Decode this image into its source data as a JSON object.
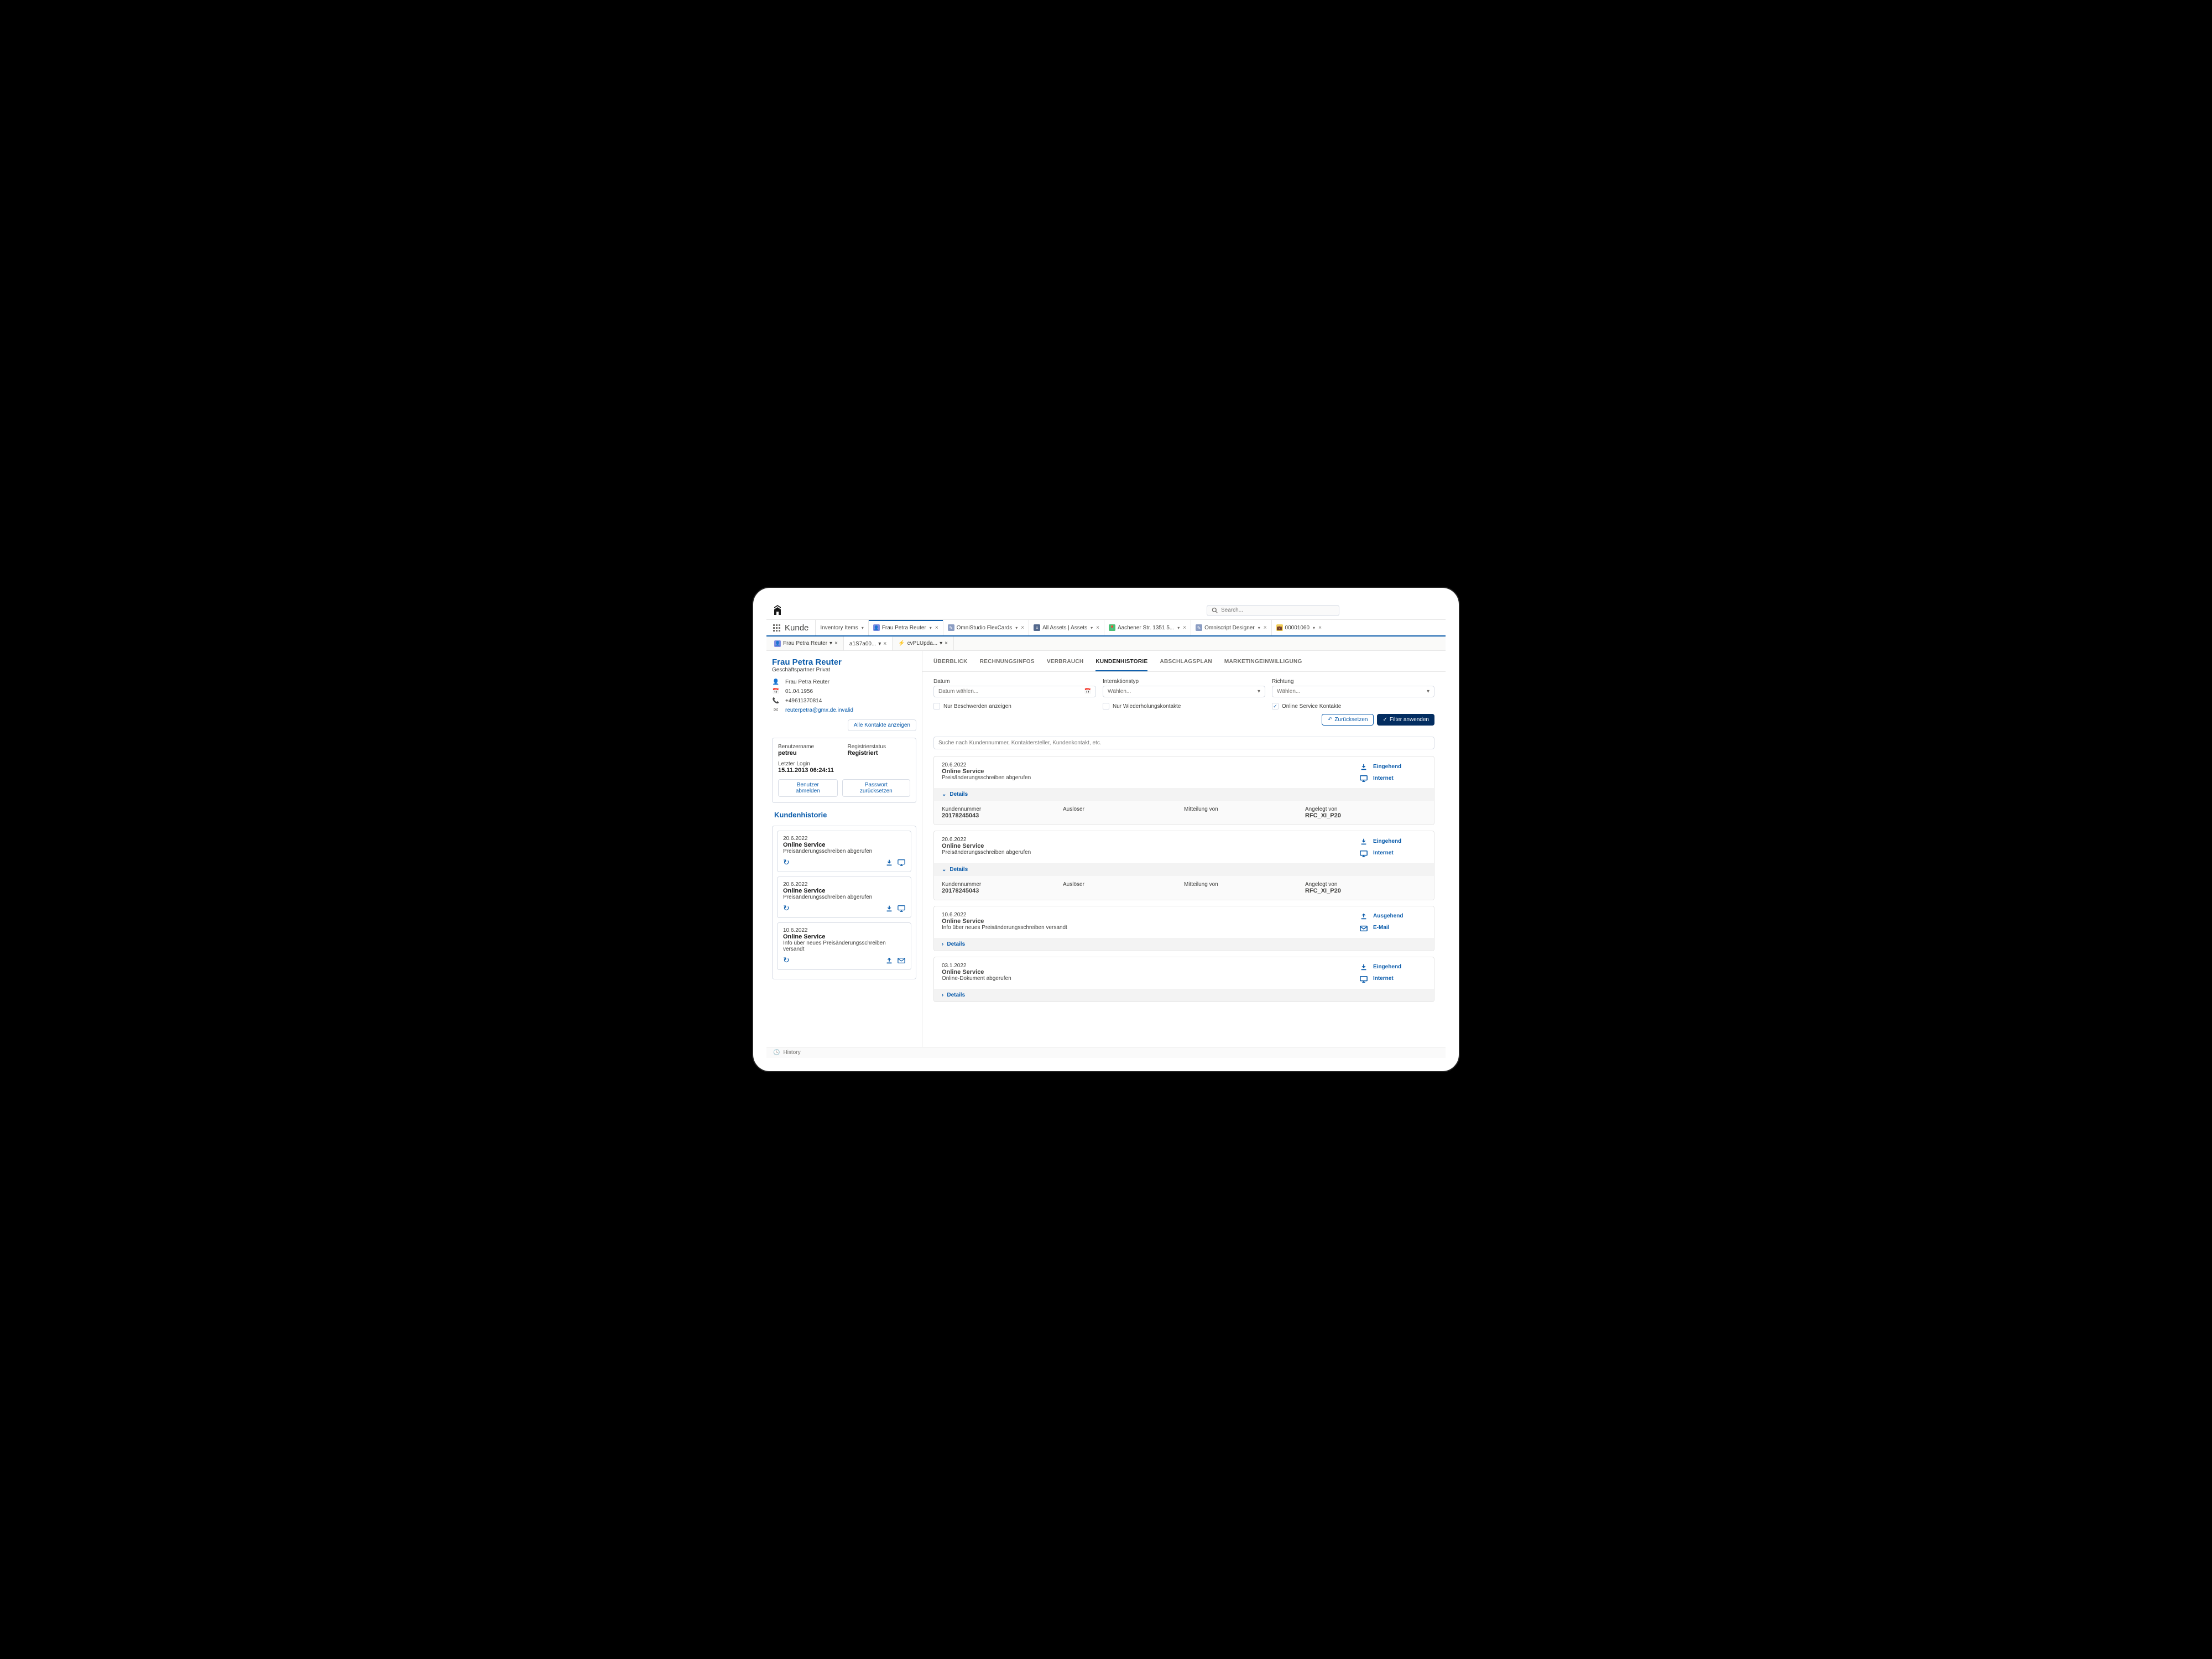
{
  "search_placeholder": "Search...",
  "app_name": "Kunde",
  "nav_tabs": [
    {
      "label": "Inventory Items",
      "icon": "",
      "has_close": false
    },
    {
      "label": "Frau Petra Reuter",
      "icon": "account",
      "has_close": true,
      "active": true
    },
    {
      "label": "OmniStudio FlexCards",
      "icon": "edit",
      "has_close": true
    },
    {
      "label": "All Assets | Assets",
      "icon": "list",
      "has_close": true
    },
    {
      "label": "Aachener Str. 1351 5...",
      "icon": "location",
      "has_close": true
    },
    {
      "label": "Omniscript Designer",
      "icon": "edit",
      "has_close": true
    },
    {
      "label": "00001060",
      "icon": "case",
      "has_close": true
    }
  ],
  "sub_tabs": [
    {
      "label": "Frau Petra Reuter",
      "icon": "account"
    },
    {
      "label": "a1S7a00...",
      "active": true
    },
    {
      "label": "cvPLUpda...",
      "icon": "bolt"
    }
  ],
  "customer": {
    "name": "Frau Petra Reuter",
    "subtitle": "Geschäftspartner Privat",
    "person": "Frau Petra Reuter",
    "birthdate": "01.04.1956",
    "phone": "+49611370814",
    "email": "reuterpetra@gmx.de.invalid",
    "show_all_contacts": "Alle Kontakte anzeigen"
  },
  "user_box": {
    "username_lbl": "Benutzername",
    "username_val": "petreu",
    "regstatus_lbl": "Registrierstatus",
    "regstatus_val": "Registriert",
    "lastlogin_lbl": "Letzter Login",
    "lastlogin_val": "15.11.2013 06:24:11",
    "btn_logout": "Benutzer abmelden",
    "btn_reset_pw": "Passwort zurücksetzen"
  },
  "sidebar_history": {
    "title": "Kundenhistorie",
    "items": [
      {
        "date": "20.6.2022",
        "title": "Online Service",
        "desc": "Preisänderungsschreiben abgerufen",
        "dir": "in"
      },
      {
        "date": "20.6.2022",
        "title": "Online Service",
        "desc": "Preisänderungsschreiben abgerufen",
        "dir": "in"
      },
      {
        "date": "10.6.2022",
        "title": "Online Service",
        "desc": "Info über neues Preisänderungsschreiben versandt",
        "dir": "out"
      }
    ]
  },
  "detail_tabs": [
    "ÜBERBLICK",
    "RECHNUNGSINFOS",
    "VERBRAUCH",
    "KUNDENHISTORIE",
    "ABSCHLAGSPLAN",
    "MARKETINGEINWILLIGUNG"
  ],
  "detail_active": "KUNDENHISTORIE",
  "filters": {
    "date_lbl": "Datum",
    "date_ph": "Datum wählen...",
    "type_lbl": "Interaktionstyp",
    "type_ph": "Wählen...",
    "dir_lbl": "Richtung",
    "dir_ph": "Wählen...",
    "chk_complaints": "Nur Beschwerden anzeigen",
    "chk_repeat": "Nur Wiederholungskontakte",
    "chk_online": "Online Service Kontakte",
    "btn_reset": "Zurücksetzen",
    "btn_apply": "Filter anwenden",
    "search_ph": "Suche nach Kundennummer, Kontaktersteller, Kundenkontakt, etc."
  },
  "history": [
    {
      "date": "20.6.2022",
      "title": "Online Service",
      "desc": "Preisänderungsschreiben abgerufen",
      "direction": "Eingehend",
      "channel": "Internet",
      "expanded": true,
      "details": {
        "kundennr_lbl": "Kundennummer",
        "kundennr_val": "20178245043",
        "ausloeser_lbl": "Auslöser",
        "ausloeser_val": "",
        "mitteilung_lbl": "Mitteilung von",
        "mitteilung_val": "",
        "angelegt_lbl": "Angelegt von",
        "angelegt_val": "RFC_XI_P20"
      },
      "toggle": "Details"
    },
    {
      "date": "20.6.2022",
      "title": "Online Service",
      "desc": "Preisänderungsschreiben abgerufen",
      "direction": "Eingehend",
      "channel": "Internet",
      "expanded": true,
      "details": {
        "kundennr_lbl": "Kundennummer",
        "kundennr_val": "20178245043",
        "ausloeser_lbl": "Auslöser",
        "ausloeser_val": "",
        "mitteilung_lbl": "Mitteilung von",
        "mitteilung_val": "",
        "angelegt_lbl": "Angelegt von",
        "angelegt_val": "RFC_XI_P20"
      },
      "toggle": "Details"
    },
    {
      "date": "10.6.2022",
      "title": "Online Service",
      "desc": "Info über neues Preisänderungsschreiben versandt",
      "direction": "Ausgehend",
      "channel": "E-Mail",
      "expanded": false,
      "toggle": "Details"
    },
    {
      "date": "03.1.2022",
      "title": "Online Service",
      "desc": "Online-Dokument abgerufen",
      "direction": "Eingehend",
      "channel": "Internet",
      "expanded": false,
      "toggle": "Details"
    }
  ],
  "footer_history": "History"
}
